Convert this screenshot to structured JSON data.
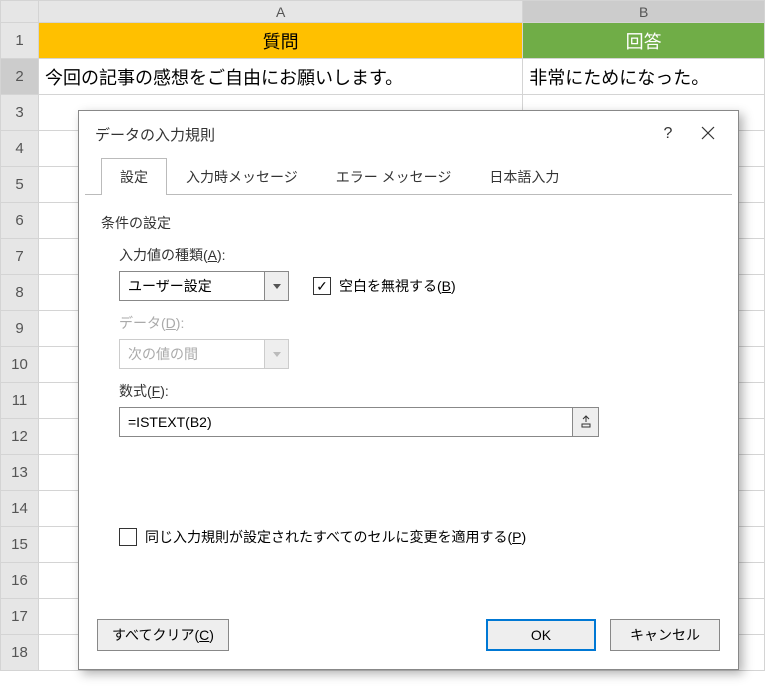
{
  "sheet": {
    "colA": "A",
    "colB": "B",
    "row1A": "質問",
    "row1B": "回答",
    "row2A": "今回の記事の感想をご自由にお願いします。",
    "row2B": "非常にためになった。",
    "rows": [
      "1",
      "2",
      "3",
      "4",
      "5",
      "6",
      "7",
      "8",
      "9",
      "10",
      "11",
      "12",
      "13",
      "14",
      "15",
      "16",
      "17",
      "18"
    ]
  },
  "dialog": {
    "title": "データの入力規則",
    "help": "?",
    "tabs": {
      "settings": "設定",
      "inputMsg": "入力時メッセージ",
      "errorMsg": "エラー メッセージ",
      "ime": "日本語入力"
    },
    "sectionLabel": "条件の設定",
    "allowLabel_pre": "入力値の種類(",
    "allowLabel_u": "A",
    "allowLabel_post": "):",
    "allowValue": "ユーザー設定",
    "ignoreBlank_pre": "空白を無視する(",
    "ignoreBlank_u": "B",
    "ignoreBlank_post": ")",
    "dataLabel_pre": "データ(",
    "dataLabel_u": "D",
    "dataLabel_post": "):",
    "dataValue": "次の値の間",
    "formulaLabel_pre": "数式(",
    "formulaLabel_u": "F",
    "formulaLabel_post": "):",
    "formulaValue": "=ISTEXT(B2)",
    "applyAll_pre": "同じ入力規則が設定されたすべてのセルに変更を適用する(",
    "applyAll_u": "P",
    "applyAll_post": ")",
    "clearAll_pre": "すべてクリア(",
    "clearAll_u": "C",
    "clearAll_post": ")",
    "ok": "OK",
    "cancel": "キャンセル"
  }
}
